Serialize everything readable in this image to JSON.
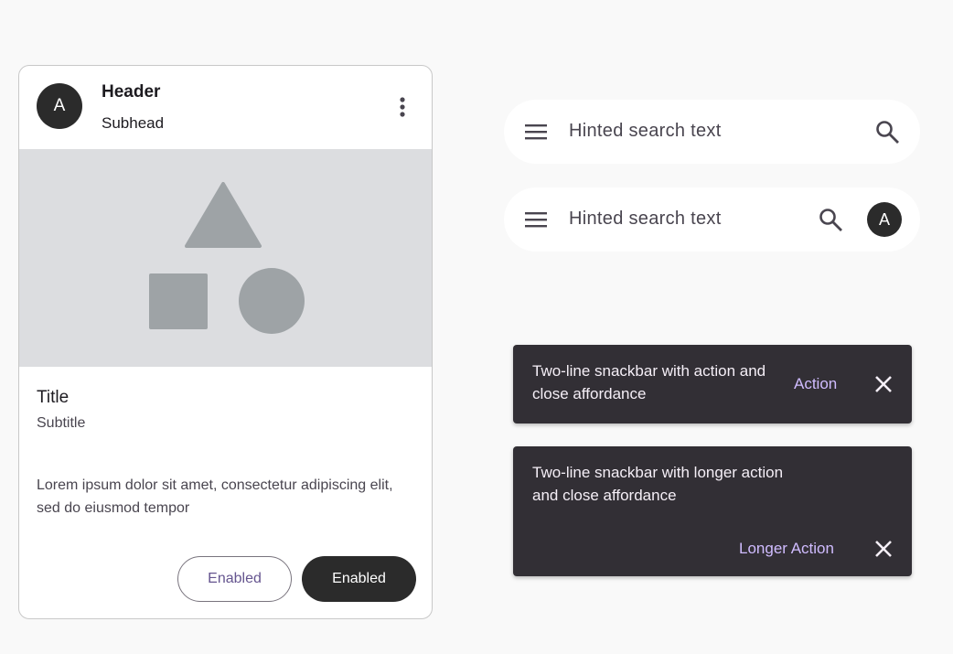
{
  "card": {
    "avatar_letter": "A",
    "header": "Header",
    "subhead": "Subhead",
    "menu_icon": "more-vert-icon",
    "media_shapes": [
      "triangle",
      "square",
      "circle"
    ],
    "title": "Title",
    "subtitle": "Subtitle",
    "body": "Lorem ipsum dolor sit amet, consectetur adipiscing elit, sed do eiusmod tempor",
    "buttons": {
      "outlined_label": "Enabled",
      "filled_label": "Enabled"
    }
  },
  "search_bars": [
    {
      "leading_icon": "menu-icon",
      "hint": "Hinted search text",
      "trailing_icon": "search-icon"
    },
    {
      "leading_icon": "menu-icon",
      "hint": "Hinted search text",
      "trailing_icon": "search-icon",
      "avatar_letter": "A"
    }
  ],
  "snackbars": [
    {
      "text": "Two-line snackbar with action and close affordance",
      "action": "Action",
      "close_icon": "close-icon"
    },
    {
      "text": "Two-line snackbar with longer action and close affordance",
      "action": "Longer Action",
      "close_icon": "close-icon"
    }
  ],
  "colors": {
    "background": "#f9f9f9",
    "surface": "#ffffff",
    "dark": "#2b2b2b",
    "media_bg": "#dcdde0",
    "media_shape": "#9ea3a6",
    "outline_text": "#65558f",
    "snackbar_bg": "#322f35",
    "snackbar_action": "#d0bcff"
  }
}
